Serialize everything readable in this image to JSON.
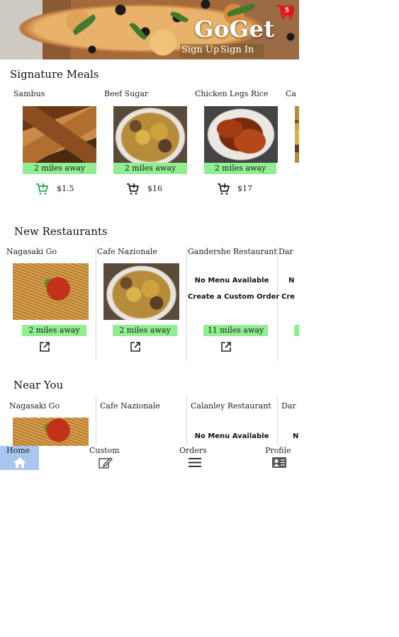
{
  "header": {
    "logo": "GoGet",
    "cart_count": "5",
    "sign_up": "Sign Up",
    "sign_in": "Sign In"
  },
  "signature": {
    "title": "Signature Meals",
    "items": [
      {
        "name": "Sambus",
        "distance": "2 miles away",
        "price": "$1.5"
      },
      {
        "name": "Beef Sugar",
        "distance": "2 miles away",
        "price": "$16"
      },
      {
        "name": "Chicken Legs Rice",
        "distance": "2 miles away",
        "price": "$17"
      },
      {
        "name": "Ca"
      }
    ]
  },
  "new_restaurants": {
    "title": "New Restaurants",
    "items": [
      {
        "name": "Nagasaki Go",
        "distance": "2 miles away"
      },
      {
        "name": "Cafe Nazionale",
        "distance": "2 miles away"
      },
      {
        "name": "Gandershe Restaurant",
        "no_menu": "No Menu Available",
        "custom": "Create a Custom Order",
        "distance": "11 miles away"
      },
      {
        "name": "Dar",
        "no_menu": "N",
        "custom": "Cre"
      }
    ]
  },
  "near_you": {
    "title": "Near You",
    "items": [
      {
        "name": "Nagasaki Go"
      },
      {
        "name": "Cafe Nazionale"
      },
      {
        "name": "Calanley Restaurant",
        "no_menu": "No Menu Available"
      },
      {
        "name": "Dar",
        "no_menu": "N"
      }
    ]
  },
  "nav": {
    "home": "Home",
    "custom": "Custom",
    "orders": "Orders",
    "profile": "Profile"
  },
  "colors": {
    "distance_badge": "#90ee90",
    "active_nav": "#a9c6ee",
    "cart_badge": "#e01818"
  }
}
